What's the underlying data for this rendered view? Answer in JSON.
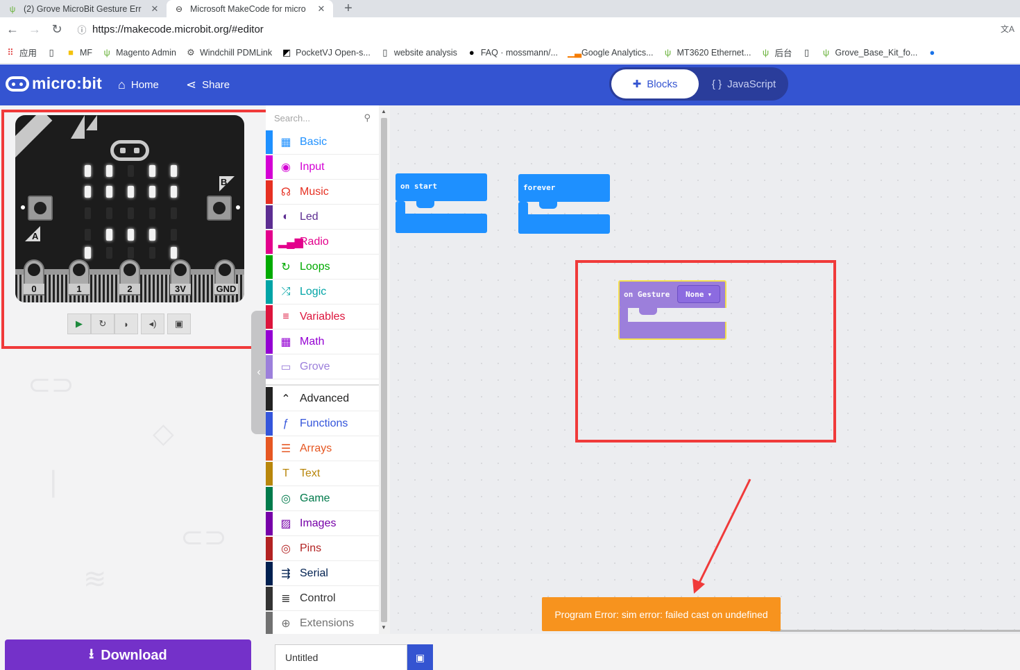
{
  "browser": {
    "tabs": [
      {
        "title": "(2) Grove MicroBit Gesture Err",
        "close": "✕",
        "active": false
      },
      {
        "title": "Microsoft MakeCode for micro",
        "close": "✕",
        "active": true
      }
    ],
    "new_tab": "+",
    "url": "https://makecode.microbit.org/#editor",
    "bookmarks": [
      {
        "label": "应用",
        "icon": "apps-grid-icon"
      },
      {
        "label": "",
        "icon": "page-icon"
      },
      {
        "label": "MF",
        "icon": "folder-icon"
      },
      {
        "label": "Magento Admin",
        "icon": "leaf-icon"
      },
      {
        "label": "Windchill PDMLink",
        "icon": "gear-icon"
      },
      {
        "label": "PocketVJ Open-s...",
        "icon": "pocketvj-icon"
      },
      {
        "label": "website analysis",
        "icon": "page-icon"
      },
      {
        "label": "FAQ · mossmann/...",
        "icon": "github-icon"
      },
      {
        "label": "Google Analytics...",
        "icon": "analytics-icon"
      },
      {
        "label": "MT3620 Ethernet...",
        "icon": "leaf-icon"
      },
      {
        "label": "后台",
        "icon": "leaf-icon"
      },
      {
        "label": "",
        "icon": "page-icon"
      },
      {
        "label": "Grove_Base_Kit_fo...",
        "icon": "leaf-icon"
      }
    ]
  },
  "header": {
    "logo": "micro:bit",
    "home": "Home",
    "share": "Share",
    "blocks": "Blocks",
    "javascript": "JavaScript",
    "accent": "#3454d1"
  },
  "simulator": {
    "pin_labels": [
      "0",
      "1",
      "2",
      "3V",
      "GND"
    ],
    "button_a": "A",
    "button_b": "B",
    "leds": [
      [
        1,
        1,
        0,
        1,
        1
      ],
      [
        1,
        1,
        1,
        1,
        1
      ],
      [
        0,
        0,
        0,
        0,
        0
      ],
      [
        0,
        1,
        1,
        1,
        0
      ],
      [
        1,
        0,
        0,
        0,
        1
      ]
    ]
  },
  "toolbox": {
    "search_placeholder": "Search...",
    "categories": [
      {
        "label": "Basic",
        "color": "#1e90ff",
        "icon": "grid-icon"
      },
      {
        "label": "Input",
        "color": "#d400d4",
        "icon": "target-icon"
      },
      {
        "label": "Music",
        "color": "#e63022",
        "icon": "headphones-icon"
      },
      {
        "label": "Led",
        "color": "#5c2d91",
        "icon": "toggle-icon"
      },
      {
        "label": "Radio",
        "color": "#e3008c",
        "icon": "signal-icon"
      },
      {
        "label": "Loops",
        "color": "#00aa00",
        "icon": "loop-icon"
      },
      {
        "label": "Logic",
        "color": "#00a4a6",
        "icon": "shuffle-icon"
      },
      {
        "label": "Variables",
        "color": "#dc143c",
        "icon": "list-icon"
      },
      {
        "label": "Math",
        "color": "#9400d3",
        "icon": "calculator-icon"
      },
      {
        "label": "Grove",
        "color": "#9c7fdb",
        "icon": "monitor-icon"
      }
    ],
    "advanced": [
      {
        "label": "Advanced",
        "color": "#222222",
        "icon": "chevron-up-icon"
      },
      {
        "label": "Functions",
        "color": "#3455db",
        "icon": "function-icon"
      },
      {
        "label": "Arrays",
        "color": "#e65722",
        "icon": "arrays-icon"
      },
      {
        "label": "Text",
        "color": "#b8860b",
        "icon": "text-icon"
      },
      {
        "label": "Game",
        "color": "#007a4b",
        "icon": "gamepad-icon"
      },
      {
        "label": "Images",
        "color": "#7600a8",
        "icon": "image-icon"
      },
      {
        "label": "Pins",
        "color": "#b22222",
        "icon": "pin-target-icon"
      },
      {
        "label": "Serial",
        "color": "#002050",
        "icon": "usb-icon"
      },
      {
        "label": "Control",
        "color": "#333333",
        "icon": "control-icon"
      },
      {
        "label": "Extensions",
        "color": "#717171",
        "icon": "plus-circle-icon"
      }
    ]
  },
  "workspace": {
    "on_start": "on start",
    "forever": "forever",
    "on_gesture": "on Gesture",
    "gesture_value": "None"
  },
  "error": "Program Error: sim error: failed cast on undefined",
  "bottom": {
    "download": "Download",
    "project_name": "Untitled"
  }
}
